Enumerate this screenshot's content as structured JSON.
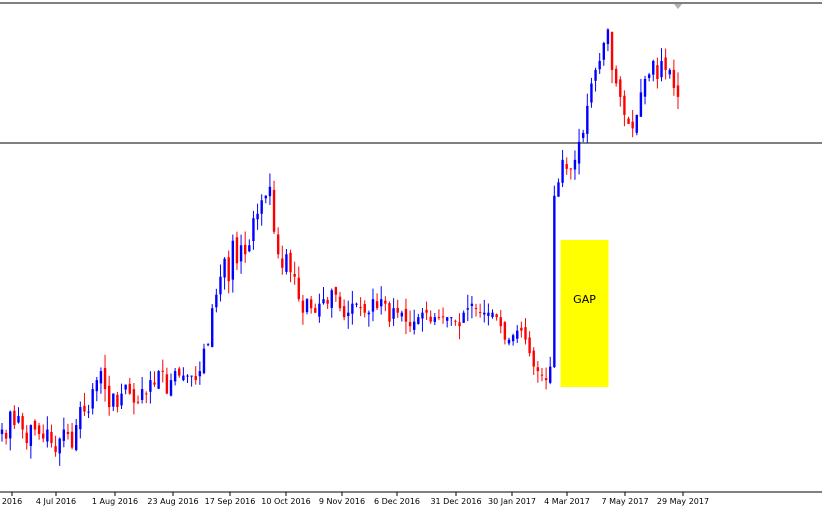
{
  "chart_data": {
    "type": "candlestick",
    "x_tick_labels": [
      "2016",
      "4 Jul 2016",
      "1 Aug 2016",
      "23 Aug 2016",
      "17 Sep 2016",
      "10 Oct 2016",
      "9 Nov 2016",
      "6 Dec 2016",
      "31 Dec 2016",
      "30 Jan 2017",
      "4 Mar 2017",
      "7 May 2017",
      "29 May 2017"
    ],
    "annotation": {
      "text": "GAP",
      "color": "#ffff00"
    },
    "colors": {
      "up": "#0000ff",
      "down": "#ff0000",
      "grid_line": "#000000",
      "axis": "#000000",
      "top_border": "#808080"
    },
    "y_axis_visible": false,
    "horizontal_line": true,
    "series": [
      {
        "start": 0.3,
        "end": 0.36,
        "values": [
          108.0,
          106.0,
          112.0,
          109.0,
          111.0,
          108.0,
          105.0,
          109.0,
          108.0,
          107.0,
          106.0,
          108.0,
          105.0,
          103.0,
          106.0,
          108.0,
          107.0,
          104.0,
          109.0,
          113.0,
          112.0,
          112.0,
          117.0,
          119.0,
          121.0,
          117.0,
          113.0,
          116.0,
          113.0,
          116.0,
          118.0,
          116.0,
          114.0,
          114.0,
          117.0,
          116.0,
          119.0,
          118.0,
          121.0,
          121.0,
          116.0,
          119.0,
          121.0,
          120.0,
          120.0,
          120.0,
          120.0,
          119.0,
          121.0,
          126.0,
          127.0,
          135.0,
          138.0,
          142.0,
          146.0,
          141.0,
          150.0,
          145.0,
          149.0,
          147.0,
          149.0,
          155.0,
          156.0,
          159.0,
          160.0,
          162.0,
          152.0,
          147.0,
          144.0,
          147.0,
          143.0,
          142.0,
          137.0,
          134.0,
          137.0,
          135.0,
          134.0,
          136.0,
          137.0,
          136.0,
          139.0,
          138.0,
          135.0,
          133.0,
          134.0,
          136.0,
          136.0,
          135.0,
          134.0,
          134.0,
          137.0,
          135.0,
          137.0,
          136.0,
          132.0,
          135.0,
          134.0,
          134.0,
          132.0,
          131.0,
          132.0,
          133.0,
          134.0,
          134.0,
          132.0,
          133.0,
          133.0,
          133.0,
          133.0,
          133.0,
          132.0,
          131.0,
          134.0,
          135.0,
          136.0,
          135.0,
          134.0,
          134.0,
          134.0,
          134.0,
          133.0,
          131.0,
          128.0,
          128.0,
          129.0,
          130.0,
          130.0,
          128.0,
          125.0,
          122.0,
          121.0,
          120.0,
          119.0,
          122.0,
          160.0,
          163.0,
          168.0,
          166.0,
          166.0,
          168.0,
          172.0,
          174.0,
          180.0,
          185.0,
          188.0,
          190.0,
          194.0,
          197.0,
          188.0,
          185.0,
          182.0,
          178.0,
          176.0,
          175.0,
          178.0,
          183.0,
          186.0,
          187.0,
          190.0,
          186.0,
          190.0,
          188.0,
          188.0,
          184.0,
          182.0
        ]
      }
    ]
  }
}
